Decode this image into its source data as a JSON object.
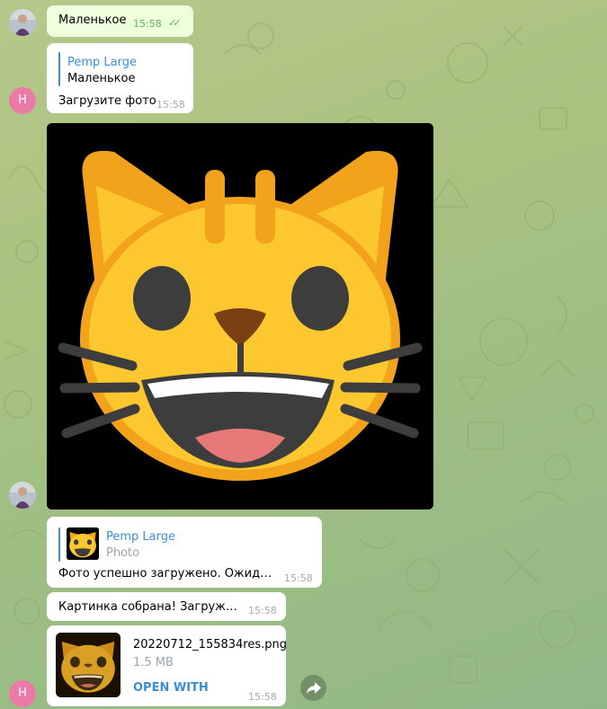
{
  "messages": {
    "m1": {
      "text": "Маленькое",
      "time": "15:58",
      "checks": "✓✓"
    },
    "m2": {
      "quote_name": "Pemp Large",
      "quote_text": "Маленькое",
      "text": "Загрузите фото",
      "time": "15:58"
    },
    "m3": {
      "quote_name": "Pemp Large",
      "quote_text": "Photo",
      "text": "Фото успешно загружено. Ожидайте...",
      "time": "15:58"
    },
    "m4": {
      "text": "Картинка собрана! Загружаем...",
      "time": "15:58"
    },
    "m5": {
      "file_name": "20220712_155834res.png",
      "file_size": "1.5 MB",
      "action": "OPEN WITH",
      "time": "15:58"
    }
  },
  "avatars": {
    "bot_initial": "H"
  },
  "icons": {
    "share": "share-arrow-icon",
    "read": "double-check-icon"
  },
  "colors": {
    "accent": "#3a8fd6",
    "outgoing_bubble": "#eeffde",
    "avatar_h": "#ea7aa6"
  }
}
